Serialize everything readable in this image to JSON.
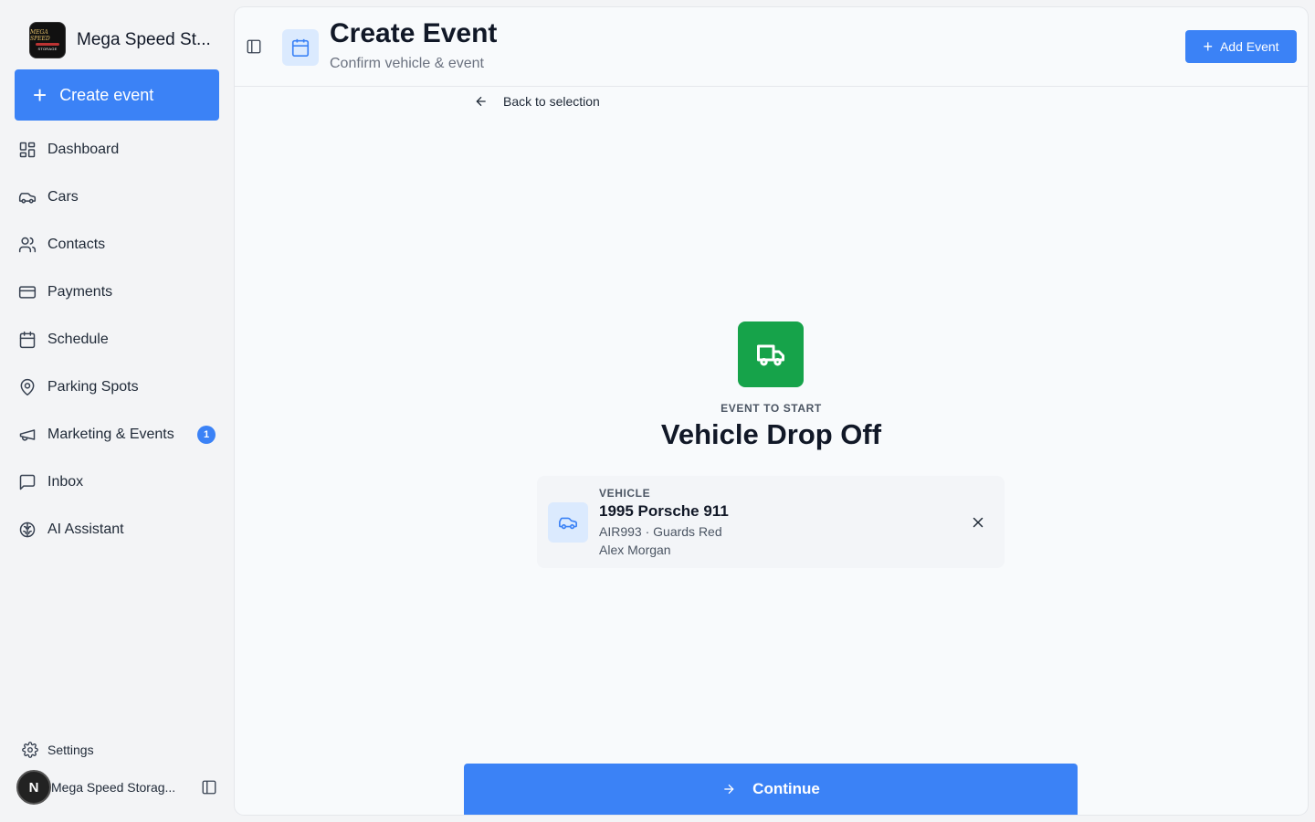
{
  "sidebar": {
    "brand_name": "Mega Speed St...",
    "logo_text_top": "MEGA SPEED",
    "logo_text_bottom": "STORAGE",
    "create_label": "Create event",
    "items": [
      {
        "label": "Dashboard",
        "icon": "dashboard-icon"
      },
      {
        "label": "Cars",
        "icon": "car-icon"
      },
      {
        "label": "Contacts",
        "icon": "users-icon"
      },
      {
        "label": "Payments",
        "icon": "credit-card-icon"
      },
      {
        "label": "Schedule",
        "icon": "calendar-icon"
      },
      {
        "label": "Parking Spots",
        "icon": "map-pin-icon"
      },
      {
        "label": "Marketing & Events",
        "icon": "megaphone-icon",
        "badge": "1"
      },
      {
        "label": "Inbox",
        "icon": "message-square-icon"
      },
      {
        "label": "AI Assistant",
        "icon": "brain-icon"
      }
    ],
    "settings_label": "Settings",
    "user": {
      "initial": "N",
      "name": "Mega Speed Storag..."
    }
  },
  "header": {
    "title": "Create Event",
    "subtitle": "Confirm vehicle & event",
    "add_label": "Add Event"
  },
  "main": {
    "back_label": "Back to selection",
    "event_kicker": "EVENT TO START",
    "event_title": "Vehicle Drop Off",
    "vehicle": {
      "label": "VEHICLE",
      "name": "1995 Porsche 911",
      "detail": "AIR993 · Guards Red",
      "owner": "Alex Morgan"
    },
    "continue_label": "Continue"
  },
  "colors": {
    "accent": "#3b82f6",
    "event_green": "#16a34a",
    "accent_light": "#dbeafe"
  }
}
